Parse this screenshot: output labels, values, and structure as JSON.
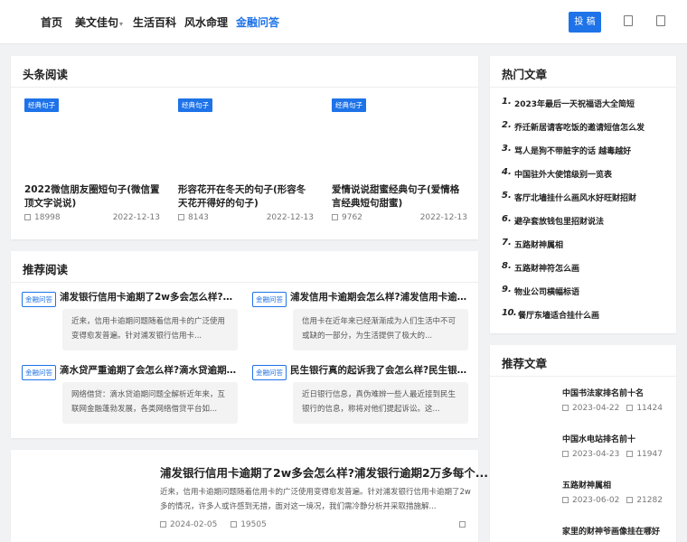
{
  "nav": {
    "items": [
      {
        "label": "首页"
      },
      {
        "label": "美文佳句"
      },
      {
        "label": "生活百科"
      },
      {
        "label": "风水命理"
      },
      {
        "label": "金融问答"
      }
    ],
    "submit_label": "投 稿",
    "accent": "#1e73e8"
  },
  "headline": {
    "title": "头条阅读",
    "items": [
      {
        "tag": "经典句子",
        "title": "2022微信朋友圈短句子(微信置顶文字说说)",
        "views": "18998",
        "date": "2022-12-13"
      },
      {
        "tag": "经典句子",
        "title": "形容花开在冬天的句子(形容冬天花开得好的句子)",
        "views": "8143",
        "date": "2022-12-13"
      },
      {
        "tag": "经典句子",
        "title": "爱情说说甜蜜经典句子(爱情格言经典短句甜蜜)",
        "views": "9762",
        "date": "2022-12-13"
      }
    ]
  },
  "recommended": {
    "title": "推荐阅读",
    "items": [
      {
        "tag": "金融问答",
        "title": "浦发银行信用卡逾期了2w多会怎么样?浦...",
        "excerpt": "近来，信用卡逾期问题随着信用卡的广泛使用变得愈发普遍。针对浦发银行信用卡..."
      },
      {
        "tag": "金融问答",
        "title": "浦发信用卡逾期会怎么样?浦发信用卡逾...",
        "excerpt": "信用卡在近年来已经渐渐成为人们生活中不可或缺的一部分，为生活提供了极大的..."
      },
      {
        "tag": "金融问答",
        "title": "滴水贷严重逾期了会怎么样?滴水贷逾期...",
        "excerpt": "网络借贷：滴水贷逾期问题全解析近年来，互联网金融蓬勃发展，各类网络借贷平台如..."
      },
      {
        "tag": "金融问答",
        "title": "民生银行真的起诉我了会怎么样?民生银...",
        "excerpt": "近日银行信息，真伪难辨一些人最近接到民生银行的信息，称将对他们提起诉讼。这..."
      }
    ]
  },
  "featured": {
    "title": "浦发银行信用卡逾期了2w多会怎么样?浦发银行逾期2万多每个...",
    "excerpt": "近来，信用卡逾期问题随着信用卡的广泛使用变得愈发普遍。针对浦发银行信用卡逾期了2w多的情况，许多人或许感到无措，面对这一境况，我们需冷静分析并采取措施解...",
    "date": "2024-02-05",
    "views": "19505"
  },
  "hot": {
    "title": "热门文章",
    "items": [
      {
        "num": "1.",
        "title": "2023年最后一天祝福语大全简短"
      },
      {
        "num": "2.",
        "title": "乔迁新居请客吃饭的邀请短信怎么发"
      },
      {
        "num": "3.",
        "title": "骂人是狗不带脏字的话 越毒越好"
      },
      {
        "num": "4.",
        "title": "中国驻外大使馆级别一览表"
      },
      {
        "num": "5.",
        "title": "客厅北墙挂什么画风水好旺财招财"
      },
      {
        "num": "6.",
        "title": "避孕套放钱包里招财说法"
      },
      {
        "num": "7.",
        "title": "五路财神属相"
      },
      {
        "num": "8.",
        "title": "五路财神符怎么画"
      },
      {
        "num": "9.",
        "title": "物业公司横幅标语"
      },
      {
        "num": "10.",
        "title": "餐厅东墙适合挂什么画"
      }
    ]
  },
  "side_articles": {
    "title": "推荐文章",
    "items": [
      {
        "title": "中国书法家排名前十名",
        "date": "2023-04-22",
        "views": "11424"
      },
      {
        "title": "中国水电站排名前十",
        "date": "2023-04-23",
        "views": "11947"
      },
      {
        "title": "五路财神属相",
        "date": "2023-06-02",
        "views": "21282"
      },
      {
        "title": "家里的财神爷画像挂在哪好",
        "date": "",
        "views": ""
      }
    ]
  }
}
